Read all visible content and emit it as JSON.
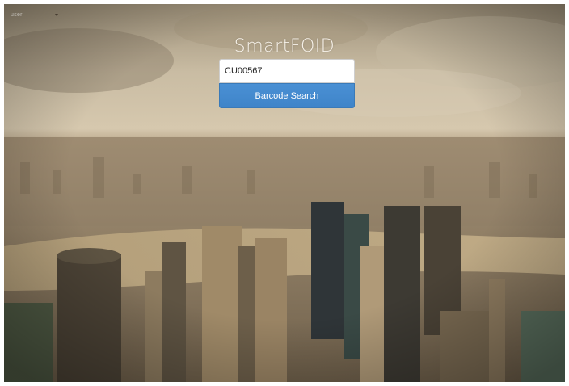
{
  "header": {
    "user_select_value": "user"
  },
  "app": {
    "title": "SmartFOID"
  },
  "search": {
    "input_value": "CU00567",
    "button_label": "Barcode Search"
  }
}
